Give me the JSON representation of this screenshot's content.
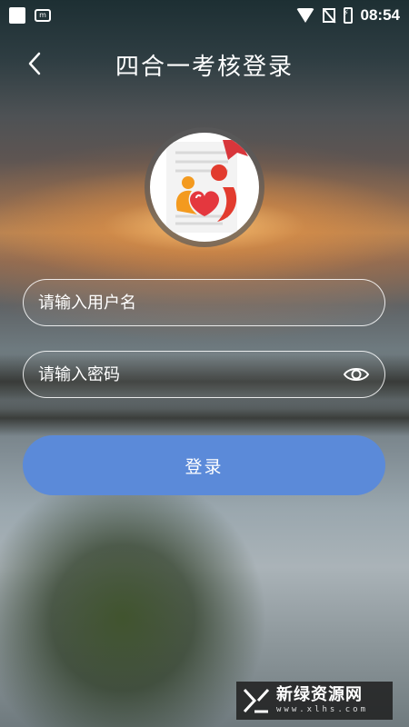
{
  "status_bar": {
    "time": "08:54",
    "icons": [
      "notification-square-icon",
      "app-notification-icon",
      "wifi-icon",
      "no-sim-icon",
      "battery-charging-icon"
    ]
  },
  "header": {
    "back_icon": "chevron-left-icon",
    "title": "四合一考核登录"
  },
  "logo": {
    "icon": "family-heart-logo"
  },
  "form": {
    "username_placeholder": "请输入用户名",
    "password_placeholder": "请输入密码",
    "show_password_icon": "eye-icon",
    "login_label": "登录"
  },
  "watermark": {
    "title": "新绿资源网",
    "subtitle": "www.xlhs.com"
  },
  "colors": {
    "button": "#5b8ad9",
    "text": "#ffffff"
  }
}
